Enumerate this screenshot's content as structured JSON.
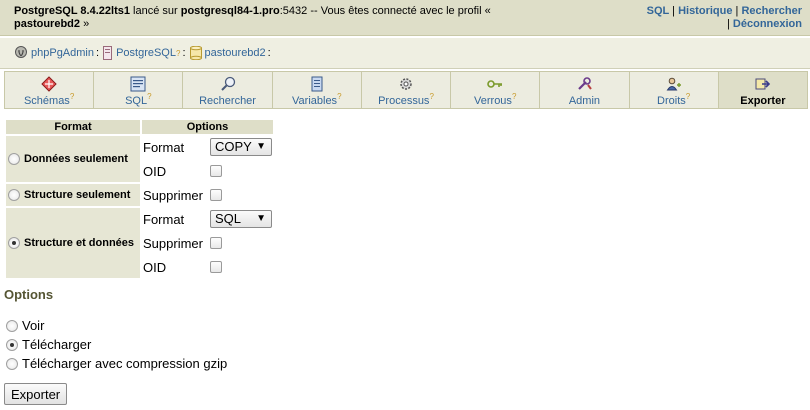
{
  "topbar": {
    "server_product": "PostgreSQL 8.4.22lts1",
    "launched_on": " lancé sur ",
    "host": "postgresql84-1.pro",
    "port": ":5432",
    "connected_text": " -- Vous êtes connecté avec le profil « ",
    "profile": "pastourebd2",
    "close_quote": " »",
    "links": {
      "sql": "SQL",
      "history": "Historique",
      "search": "Rechercher",
      "logout": "Déconnexion"
    }
  },
  "breadcrumb": {
    "app": "phpPgAdmin",
    "server": "PostgreSQL",
    "help_mark": "?",
    "database": "pastourebd2",
    "colon": ":"
  },
  "tabs": [
    {
      "label": "Schémas",
      "help": "?",
      "icon": "schemas-icon"
    },
    {
      "label": "SQL",
      "help": "?",
      "icon": "sql-icon"
    },
    {
      "label": "Rechercher",
      "help": "",
      "icon": "search-icon"
    },
    {
      "label": "Variables",
      "help": "?",
      "icon": "variables-icon"
    },
    {
      "label": "Processus",
      "help": "?",
      "icon": "processes-icon"
    },
    {
      "label": "Verrous",
      "help": "?",
      "icon": "locks-icon"
    },
    {
      "label": "Admin",
      "help": "",
      "icon": "admin-icon"
    },
    {
      "label": "Droits",
      "help": "?",
      "icon": "privileges-icon"
    },
    {
      "label": "Exporter",
      "help": "",
      "icon": "export-icon",
      "active": true
    }
  ],
  "export_table": {
    "headers": {
      "format": "Format",
      "options": "Options"
    },
    "data_only": {
      "label": "Données seulement",
      "format_label": "Format",
      "format_value": "COPY",
      "oid_label": "OID"
    },
    "structure_only": {
      "label": "Structure seulement",
      "drop_label": "Supprimer"
    },
    "structure_and_data": {
      "label": "Structure et données",
      "format_label": "Format",
      "format_value": "SQL",
      "drop_label": "Supprimer",
      "oid_label": "OID",
      "selected": true
    }
  },
  "options": {
    "title": "Options",
    "items": [
      {
        "label": "Voir",
        "selected": false
      },
      {
        "label": "Télécharger",
        "selected": true
      },
      {
        "label": "Télécharger avec compression gzip",
        "selected": false
      }
    ]
  },
  "submit": {
    "label": "Exporter"
  },
  "colors": {
    "header_bg": "#dedec8",
    "link": "#336699",
    "section_title": "#555533",
    "help_mark": "#c89a2a"
  }
}
